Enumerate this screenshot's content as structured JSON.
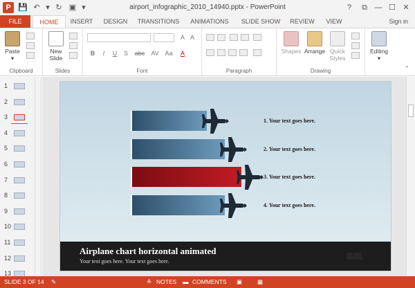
{
  "window": {
    "title": "airport_infographic_2010_14940.pptx - PowerPoint",
    "controls": [
      "?",
      "⧉",
      "—",
      "☐",
      "✕"
    ]
  },
  "ribbon_tabs": {
    "file": "FILE",
    "tabs": [
      "HOME",
      "INSERT",
      "DESIGN",
      "TRANSITIONS",
      "ANIMATIONS",
      "SLIDE SHOW",
      "REVIEW",
      "VIEW"
    ],
    "active": "HOME",
    "sign_in": "Sign in"
  },
  "ribbon": {
    "clipboard": {
      "label": "Clipboard",
      "paste": "Paste"
    },
    "slides": {
      "label": "Slides",
      "new_slide_line1": "New",
      "new_slide_line2": "Slide"
    },
    "font": {
      "label": "Font",
      "bold": "B",
      "italic": "I",
      "underline": "U",
      "strike": "S",
      "shadow": "abc",
      "spacing": "AV",
      "case": "Aa",
      "color": "A"
    },
    "paragraph": {
      "label": "Paragraph"
    },
    "drawing": {
      "label": "Drawing",
      "shapes": "Shapes",
      "arrange": "Arrange",
      "quick_styles_1": "Quick",
      "quick_styles_2": "Styles"
    },
    "editing": {
      "label": "Editing"
    }
  },
  "thumbnails": [
    "1",
    "2",
    "3",
    "4",
    "5",
    "6",
    "7",
    "8",
    "9",
    "10",
    "11",
    "12",
    "13"
  ],
  "selected_slide": "3",
  "slide": {
    "bars": [
      {
        "label": "1. Your text goes here.",
        "value": 0.55,
        "color": "blue"
      },
      {
        "label": "2. Your text goes here.",
        "value": 0.68,
        "color": "blue"
      },
      {
        "label": "3. Your text goes here.",
        "value": 0.8,
        "color": "red"
      },
      {
        "label": "4. Your text goes here.",
        "value": 0.68,
        "color": "blue"
      }
    ],
    "title": "Airplane chart horizontal animated",
    "subtitle": "Your text goes here. Your text goes here.",
    "accent_red": "#c21b23",
    "accent_blue": "#3d6482"
  },
  "status": {
    "slide_info": "SLIDE 3 OF 14",
    "notes": "NOTES",
    "comments": "COMMENTS"
  },
  "theme": {
    "brand": "#d04423"
  }
}
